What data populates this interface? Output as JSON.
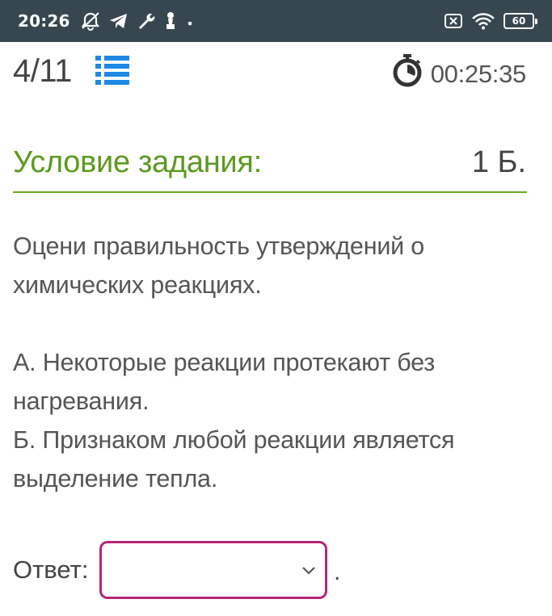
{
  "status_bar": {
    "time": "20:26",
    "battery": "60",
    "icons": [
      "alarm-off-icon",
      "telegram-icon",
      "wrench-icon",
      "chess-pawn-icon",
      "dot-icon",
      "sim-x-icon",
      "wifi-icon",
      "battery-icon"
    ]
  },
  "header": {
    "progress": "4/11",
    "list_icon": "list-icon",
    "timer_icon": "stopwatch-icon",
    "timer": "00:25:35"
  },
  "section": {
    "title": "Условие задания:",
    "points": "1 Б."
  },
  "task": {
    "lines": [
      "Оцени правильность утверждений о",
      "химических реакциях.",
      "А. Некоторые реакции протекают без",
      "нагревания.",
      "Б. Признаком любой реакции является",
      "выделение тепла."
    ]
  },
  "answer": {
    "label": "Ответ:",
    "selected": "",
    "suffix": "."
  },
  "colors": {
    "status_bar": "#37474f",
    "accent_green": "#5b9a1e",
    "list_icon_blue": "#1e88e5",
    "select_border": "#b5257a"
  }
}
